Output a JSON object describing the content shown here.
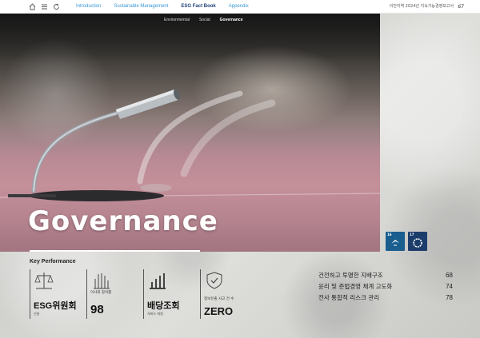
{
  "topnav": {
    "tabs": [
      {
        "label": "Introduction"
      },
      {
        "label": "Sustainable Management"
      },
      {
        "label": "ESG Fact Book"
      },
      {
        "label": "Appendix"
      }
    ],
    "active_tab": "ESG Fact Book",
    "report_title": "이천지역 2024년 지속가능경영보고서",
    "page_number": "67",
    "icons": [
      "home-icon",
      "menu-icon",
      "refresh-icon"
    ]
  },
  "subnav": {
    "items": [
      {
        "label": "Environmental"
      },
      {
        "label": "Social"
      },
      {
        "label": "Governance"
      }
    ],
    "active": "Governance"
  },
  "hero": {
    "title": "Governance"
  },
  "sdg_badges": [
    {
      "number": "16",
      "color": "#1a5d8f"
    },
    {
      "number": "17",
      "color": "#1c3d6b"
    }
  ],
  "key_performance": {
    "title": "Key Performance",
    "items": [
      {
        "label": "",
        "value": "ESG위원회",
        "caption": "신설",
        "icon": "scales-icon"
      },
      {
        "label": "이사회 참석률",
        "value": "98",
        "caption": "",
        "icon": "hand-icon"
      },
      {
        "label": "",
        "value": "배당조회",
        "caption": "서비스 개설",
        "icon": "bar-chart-icon"
      },
      {
        "label": "정보유출 사고 건 수",
        "value": "ZERO",
        "caption": "",
        "icon": "shield-check-icon"
      }
    ]
  },
  "toc": [
    {
      "label": "건전하고 투명한 지배구조",
      "page": "68"
    },
    {
      "label": "윤리 및 준법경영 체계 고도화",
      "page": "74"
    },
    {
      "label": "전사 통합적 리스크 관리",
      "page": "78"
    }
  ]
}
